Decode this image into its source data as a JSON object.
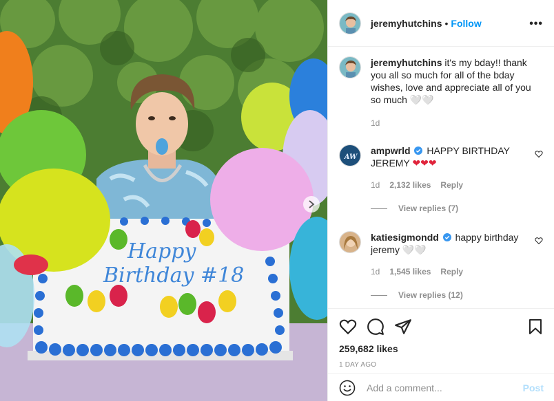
{
  "post": {
    "username": "jeremyhutchins",
    "separator": "•",
    "follow_label": "Follow",
    "more_label": "•••",
    "next_icon": "chevron-right-icon"
  },
  "caption": {
    "username": "jeremyhutchins",
    "text": "it's my bday!! thank you all so much for all of the bday wishes, love and appreciate all of you so much 🤍🤍",
    "time": "1d"
  },
  "comments": [
    {
      "username": "ampwrld",
      "verified": true,
      "text": "HAPPY BIRTHDAY JEREMY",
      "hearts": "❤❤❤",
      "time": "1d",
      "likes": "2,132 likes",
      "reply_label": "Reply",
      "view_replies": "View replies (7)"
    },
    {
      "username": "katiesigmondd",
      "verified": true,
      "text": "happy birthday jeremy 🤍🤍",
      "time": "1d",
      "likes": "1,545 likes",
      "reply_label": "Reply",
      "view_replies": "View replies (12)"
    }
  ],
  "actions": {
    "likes": "259,682 likes",
    "date": "1 DAY AGO"
  },
  "composer": {
    "placeholder": "Add a comment...",
    "post_label": "Post"
  },
  "photo": {
    "cake_text_line1": "Happy",
    "cake_text_line2": "Birthday #18"
  },
  "colors": {
    "accent": "#0095f6",
    "verified": "#3897f0",
    "muted": "#8e8e8e"
  }
}
